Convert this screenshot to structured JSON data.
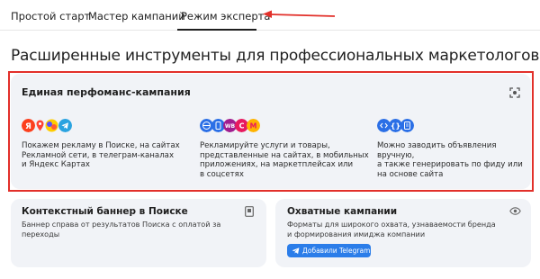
{
  "tabs": [
    {
      "label": "Простой старт"
    },
    {
      "label": "Мастер кампаний"
    },
    {
      "label": "Режим эксперта",
      "active": true
    }
  ],
  "page_title": "Расширенные инструменты для профессиональных маркетологов",
  "main_card": {
    "title": "Единая перфоманс-кампания",
    "features": [
      {
        "icons": [
          "yandex-icon",
          "map-pin-icon",
          "colored-logo-icon",
          "telegram-icon"
        ],
        "text": [
          "Покажем рекламу в Поиске, на сайтах",
          "Рекламной сети, в телеграм-каналах",
          "и Яндекс Картах"
        ]
      },
      {
        "icons": [
          "globe-icon",
          "mobile-app-icon",
          "wb-icon",
          "ozon-icon",
          "market-icon"
        ],
        "text": [
          "Рекламируйте услуги и товары,",
          "представленные на сайтах, в мобильных",
          "приложениях, на маркетплейсах или",
          "в соцсетях"
        ]
      },
      {
        "icons": [
          "link-icon",
          "code-braces-icon",
          "document-icon"
        ],
        "text": [
          "Можно заводить объявления вручную,",
          "а также генерировать по фиду или",
          "на основе сайта"
        ]
      }
    ]
  },
  "cards": [
    {
      "title": "Контекстный баннер в Поиске",
      "description": [
        "Баннер справа от результатов Поиска с оплатой за переходы"
      ]
    },
    {
      "title": "Охватные кампании",
      "description": [
        "Форматы для широкого охвата, узнаваемости бренда",
        "и формирования имиджа компании"
      ],
      "button_label": "Добавили Telegram"
    }
  ],
  "colors": {
    "accent": "#2b7de9",
    "highlight_border": "#e2302a",
    "card_bg": "#f1f3f7",
    "arrow": "#e2302a"
  }
}
